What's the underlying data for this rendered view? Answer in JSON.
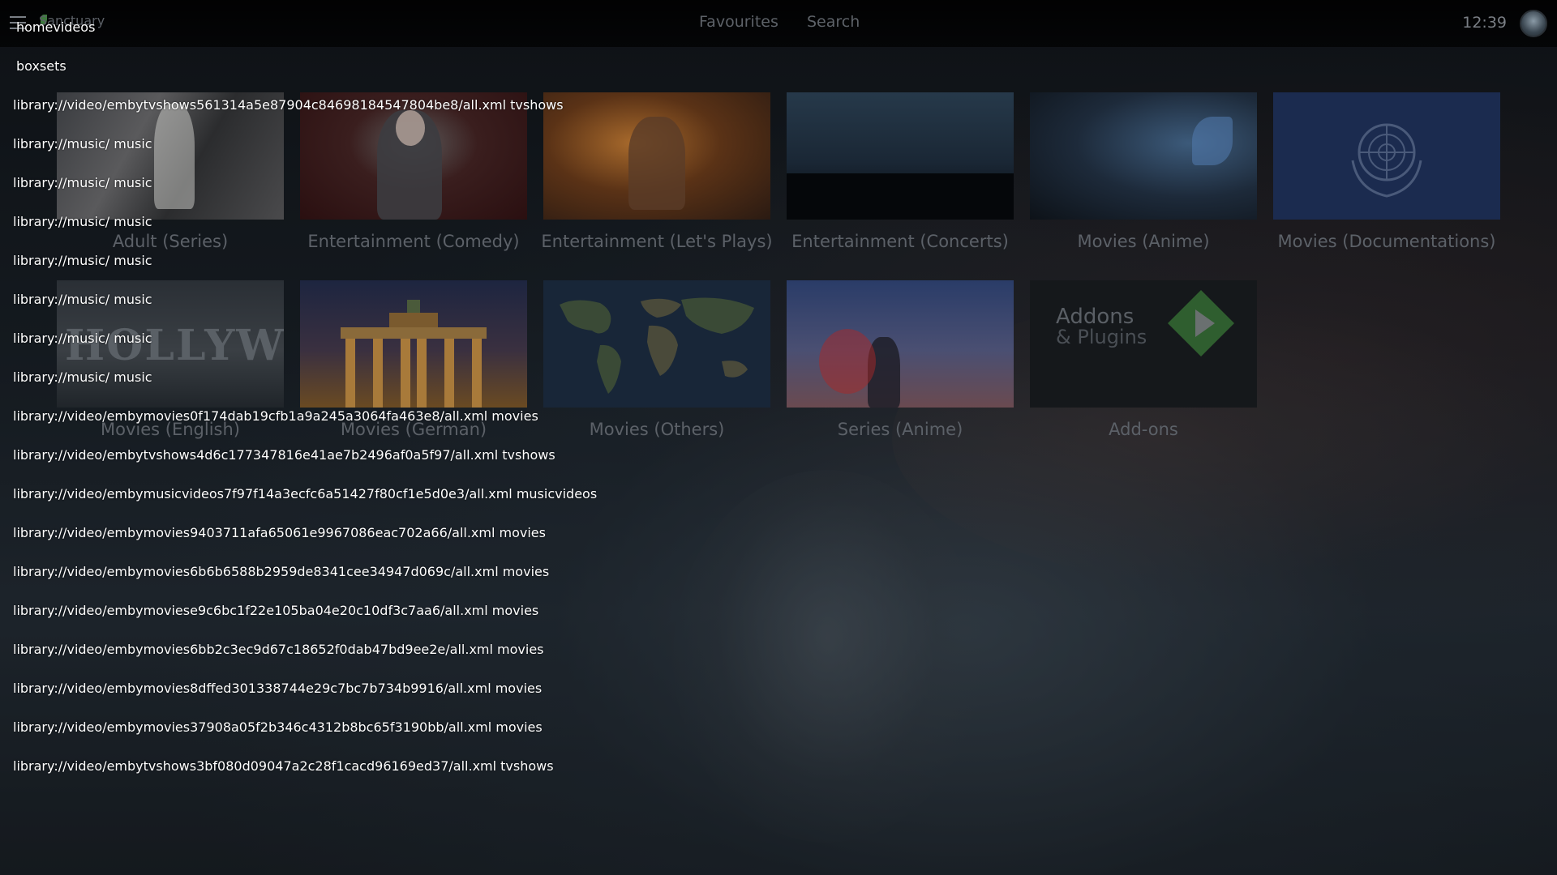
{
  "topbar": {
    "brand": "Sanctuary",
    "nav": {
      "favourites": "Favourites",
      "search": "Search"
    },
    "clock": "12:39"
  },
  "tiles": {
    "row1": [
      {
        "label": "Adult (Series)"
      },
      {
        "label": "Entertainment (Comedy)"
      },
      {
        "label": "Entertainment (Let's Plays)"
      },
      {
        "label": "Entertainment (Concerts)"
      },
      {
        "label": "Movies (Anime)"
      },
      {
        "label": "Movies (Documentations)"
      }
    ],
    "row2": [
      {
        "label": "Movies (English)"
      },
      {
        "label": "Movies (German)"
      },
      {
        "label": "Movies (Others)"
      },
      {
        "label": "Series (Anime)"
      },
      {
        "label": "Add-ons"
      }
    ],
    "addons_tile": {
      "line1": "Addons",
      "line2": "& Plugins"
    },
    "hollywood_tile": {
      "text": "HOLLYWOOD"
    }
  },
  "overlay_list": [
    "homevideos",
    "boxsets",
    "library://video/embytvshows561314a5e87904c84698184547804be8/all.xml tvshows",
    "library://music/ music",
    "library://music/ music",
    "library://music/ music",
    "library://music/ music",
    "library://music/ music",
    "library://music/ music",
    "library://music/ music",
    "library://video/embymovies0f174dab19cfb1a9a245a3064fa463e8/all.xml movies",
    "library://video/embytvshows4d6c177347816e41ae7b2496af0a5f97/all.xml tvshows",
    "library://video/embymusicvideos7f97f14a3ecfc6a51427f80cf1e5d0e3/all.xml musicvideos",
    "library://video/embymovies9403711afa65061e9967086eac702a66/all.xml movies",
    "library://video/embymovies6b6b6588b2959de8341cee34947d069c/all.xml movies",
    "library://video/embymoviese9c6bc1f22e105ba04e20c10df3c7aa6/all.xml movies",
    "library://video/embymovies6bb2c3ec9d67c18652f0dab47bd9ee2e/all.xml movies",
    "library://video/embymovies8dffed301338744e29c7bc7b734b9916/all.xml movies",
    "library://video/embymovies37908a05f2b346c4312b8bc65f3190bb/all.xml movies",
    "library://video/embytvshows3bf080d09047a2c28f1cacd96169ed37/all.xml tvshows"
  ],
  "colors": {
    "overlay_text": "#ffffff",
    "dim_text": "#5c6168",
    "addons_green": "#3a6e3a",
    "un_blue": "#1b2b4f"
  },
  "icons": {
    "menu": "hamburger-menu-icon",
    "avatar": "user-avatar-icon",
    "addons": "play-diamond-icon",
    "un": "un-emblem-icon"
  }
}
